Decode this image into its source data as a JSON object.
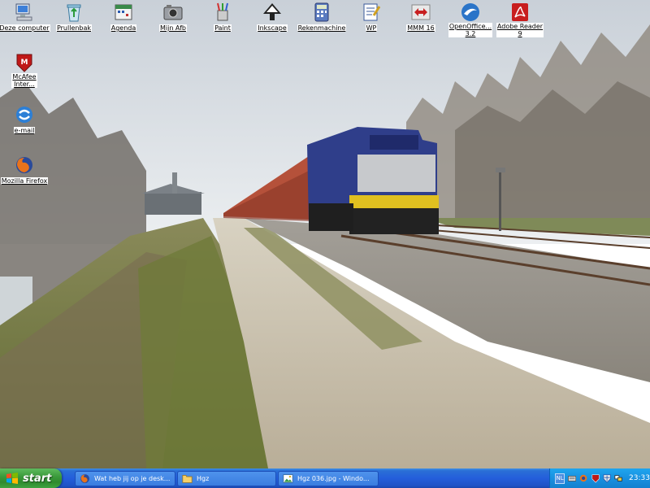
{
  "desktop": {
    "icons": [
      {
        "label": "Deze computer",
        "icon": "my-computer-icon"
      },
      {
        "label": "Prullenbak",
        "icon": "recycle-bin-icon"
      },
      {
        "label": "Agenda",
        "icon": "calendar-icon"
      },
      {
        "label": "Mijn Afb",
        "icon": "camera-icon"
      },
      {
        "label": "Paint",
        "icon": "paint-icon"
      },
      {
        "label": "Inkscape",
        "icon": "inkscape-icon"
      },
      {
        "label": "Rekenmachine",
        "icon": "calculator-icon"
      },
      {
        "label": "WP",
        "icon": "wordpad-icon"
      },
      {
        "label": "MMM 16",
        "icon": "mmm-icon"
      },
      {
        "label": "OpenOffice... 3.2",
        "icon": "openoffice-icon"
      },
      {
        "label": "Adobe Reader 9",
        "icon": "adobe-reader-icon"
      },
      {
        "label": "McAfee Inter...",
        "icon": "mcafee-icon"
      },
      {
        "label": "e-mail",
        "icon": "email-icon"
      },
      {
        "label": "Mozilla Firefox",
        "icon": "firefox-icon"
      }
    ],
    "openoffice_line1": "OpenOffice...",
    "openoffice_line2": "3.2",
    "adobe_line1": "Adobe Reader",
    "adobe_line2": "9",
    "mcafee_line1": "McAfee",
    "mcafee_line2": "Inter..."
  },
  "taskbar": {
    "start_label": "start",
    "tasks": [
      {
        "label": "Wat heb jij op je desk...",
        "icon": "firefox-icon"
      },
      {
        "label": "Hgz",
        "icon": "folder-icon"
      },
      {
        "label": "Hgz 036.jpg - Windo...",
        "icon": "image-viewer-icon"
      }
    ],
    "tray": {
      "language": "NL",
      "clock": "23:33"
    }
  },
  "colors": {
    "taskbar_blue": "#245edb",
    "start_green": "#3c9b3c",
    "tray_blue": "#1891e0"
  }
}
